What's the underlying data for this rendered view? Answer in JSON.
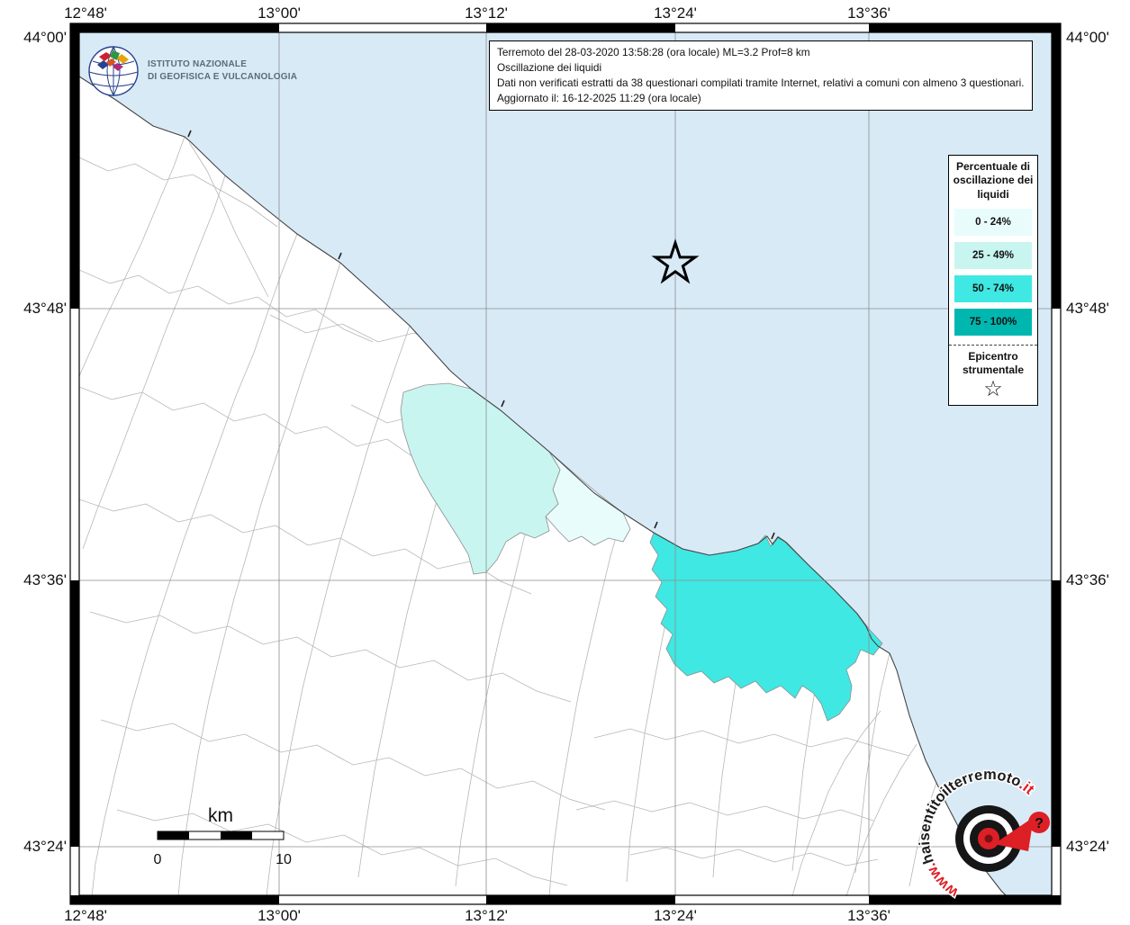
{
  "axes": {
    "top": [
      "12°48'",
      "13°00'",
      "13°12'",
      "13°24'",
      "13°36'"
    ],
    "bottom": [
      "12°48'",
      "13°00'",
      "13°12'",
      "13°24'",
      "13°36'"
    ],
    "left": [
      "44°00'",
      "43°48'",
      "43°36'",
      "43°24'"
    ],
    "right": [
      "44°00'",
      "43°48'",
      "43°36'",
      "43°24'"
    ]
  },
  "info_box": {
    "line1": "Terremoto del 28-03-2020 13:58:28 (ora locale) ML=3.2 Prof=8 km",
    "line2": "Oscillazione dei liquidi",
    "line3": "Dati non verificati estratti da 38 questionari compilati tramite Internet, relativi a comuni con almeno 3 questionari.",
    "line4": "Aggiornato il: 16-12-2025 11:29 (ora locale)"
  },
  "ingv_logo": {
    "line1": "ISTITUTO NAZIONALE",
    "line2": "DI GEOFISICA E VULCANOLOGIA"
  },
  "legend": {
    "title": "Percentuale di oscillazione dei liquidi",
    "items": [
      {
        "label": "0 - 24%",
        "color": "#e8fcfc"
      },
      {
        "label": "25 - 49%",
        "color": "#c9f5f0"
      },
      {
        "label": "50 - 74%",
        "color": "#3fe8e2"
      },
      {
        "label": "75 - 100%",
        "color": "#00b7b0"
      }
    ],
    "epicenter_line1": "Epicentro",
    "epicenter_line2": "strumentale",
    "star_glyph": "☆"
  },
  "scale_bar": {
    "unit": "km",
    "start_label": "0",
    "end_label": "10"
  },
  "watermark": {
    "prefix": "www.",
    "name": "haisentitoilterremoto",
    "tld": ".it",
    "bubble": "?"
  },
  "colors": {
    "sea": "#d9eaf7",
    "land": "#ffffff",
    "grid": "#8c8c8c",
    "boundary": "#b6b6b6",
    "coastline": "#444444",
    "pct_0_24": "#e8fcfc",
    "pct_25_49": "#c9f5f0",
    "pct_50_74": "#3fe8e2",
    "pct_75_100": "#00b7b0",
    "watermark_red": "#dd1f26"
  }
}
